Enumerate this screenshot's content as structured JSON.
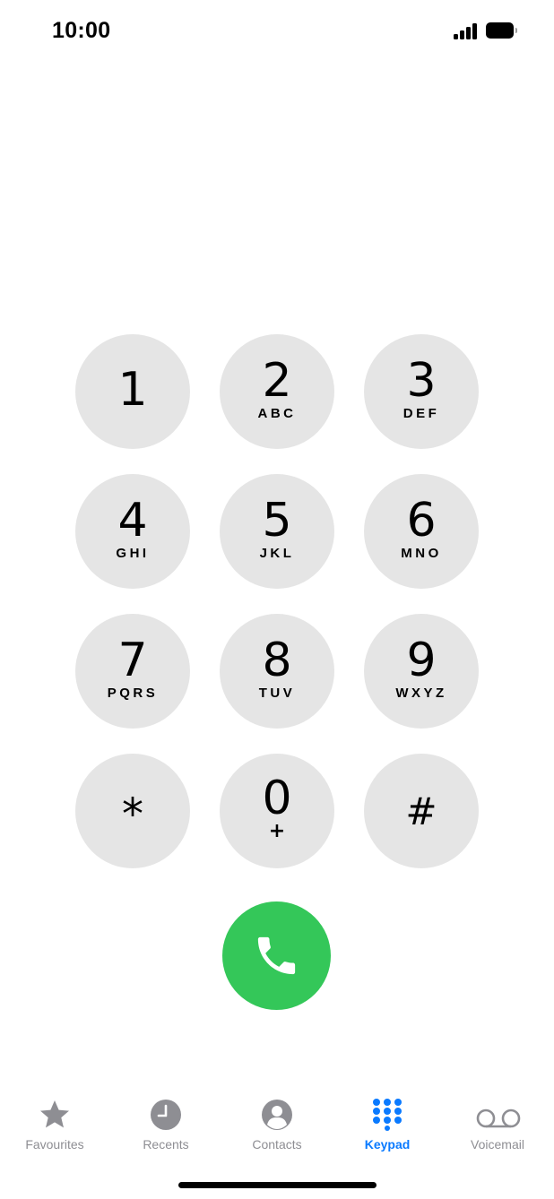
{
  "status_bar": {
    "time": "10:00",
    "signal_icon": "cellular-signal-icon",
    "battery_icon": "battery-full-icon"
  },
  "keypad": {
    "keys": [
      {
        "digit": "1",
        "letters": ""
      },
      {
        "digit": "2",
        "letters": "ABC"
      },
      {
        "digit": "3",
        "letters": "DEF"
      },
      {
        "digit": "4",
        "letters": "GHI"
      },
      {
        "digit": "5",
        "letters": "JKL"
      },
      {
        "digit": "6",
        "letters": "MNO"
      },
      {
        "digit": "7",
        "letters": "PQRS"
      },
      {
        "digit": "8",
        "letters": "TUV"
      },
      {
        "digit": "9",
        "letters": "WXYZ"
      },
      {
        "digit": "*",
        "letters": ""
      },
      {
        "digit": "0",
        "letters": "+"
      },
      {
        "digit": "#",
        "letters": ""
      }
    ],
    "key_color": "#e5e5e5"
  },
  "call_button": {
    "icon": "phone-icon",
    "color": "#34c759"
  },
  "tab_bar": {
    "active_color": "#0a7aff",
    "inactive_color": "#8e8e93",
    "tabs": [
      {
        "label": "Favourites",
        "icon": "star-icon",
        "active": false
      },
      {
        "label": "Recents",
        "icon": "clock-icon",
        "active": false
      },
      {
        "label": "Contacts",
        "icon": "person-circle-icon",
        "active": false
      },
      {
        "label": "Keypad",
        "icon": "keypad-grid-icon",
        "active": true
      },
      {
        "label": "Voicemail",
        "icon": "voicemail-icon",
        "active": false
      }
    ]
  }
}
